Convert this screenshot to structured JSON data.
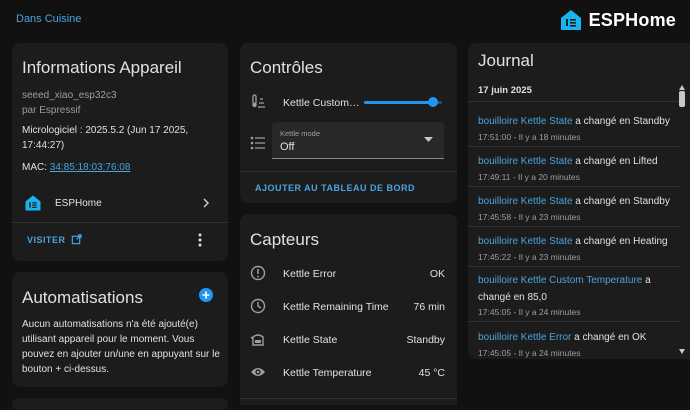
{
  "header": {
    "breadcrumb": "Dans Cuisine",
    "brand": "ESPHome",
    "brand_color": "#18b4f1"
  },
  "device_info": {
    "title": "Informations Appareil",
    "model": "seeed_xiao_esp32c3",
    "manufacturer": "par Espressif",
    "firmware_line1": "Micrologiciel : 2025.5.2 (Jun 17 2025,",
    "firmware_line2": "17:44:27)",
    "mac_label": "MAC: ",
    "mac_value": "34:85:18:03:76:08",
    "integration": "ESPHome",
    "visit_label": "VISITER"
  },
  "automations": {
    "title": "Automatisations",
    "body": "Aucun automatisations n'a été ajouté(e) utilisant appareil pour le moment. Vous pouvez en ajouter un/une en appuyant sur le bouton + ci-dessus."
  },
  "controls": {
    "title": "Contrôles",
    "slider_label": "Kettle Custom…",
    "slider_fraction": 0.88,
    "select_label": "Kettle mode",
    "select_value": "Off",
    "add_dashboard": "AJOUTER AU TABLEAU DE BORD"
  },
  "sensors": {
    "title": "Capteurs",
    "rows": [
      {
        "label": "Kettle Error",
        "value": "OK"
      },
      {
        "label": "Kettle Remaining Time",
        "value": "76 min"
      },
      {
        "label": "Kettle State",
        "value": "Standby"
      },
      {
        "label": "Kettle Temperature",
        "value": "45 °C"
      }
    ]
  },
  "journal": {
    "title": "Journal",
    "date": "17 juin 2025",
    "entries": [
      {
        "entity": "bouilloire Kettle State",
        "msg": " a changé en Standby",
        "time": "17:51:00 - Il y a 18 minutes"
      },
      {
        "entity": "bouilloire Kettle State",
        "msg": " a changé en Lifted",
        "time": "17:49:11 - Il y a 20 minutes"
      },
      {
        "entity": "bouilloire Kettle State",
        "msg": " a changé en Standby",
        "time": "17:45:58 - Il y a 23 minutes"
      },
      {
        "entity": "bouilloire Kettle State",
        "msg": " a changé en Heating",
        "time": "17:45:22 - Il y a 23 minutes"
      },
      {
        "entity": "bouilloire Kettle Custom Temperature",
        "msg": " a changé en 85,0",
        "time": "17:45:05 - Il y a 24 minutes"
      },
      {
        "entity": "bouilloire Kettle Error",
        "msg": " a changé en OK",
        "time": "17:45:05 - Il y a 24 minutes"
      }
    ]
  }
}
